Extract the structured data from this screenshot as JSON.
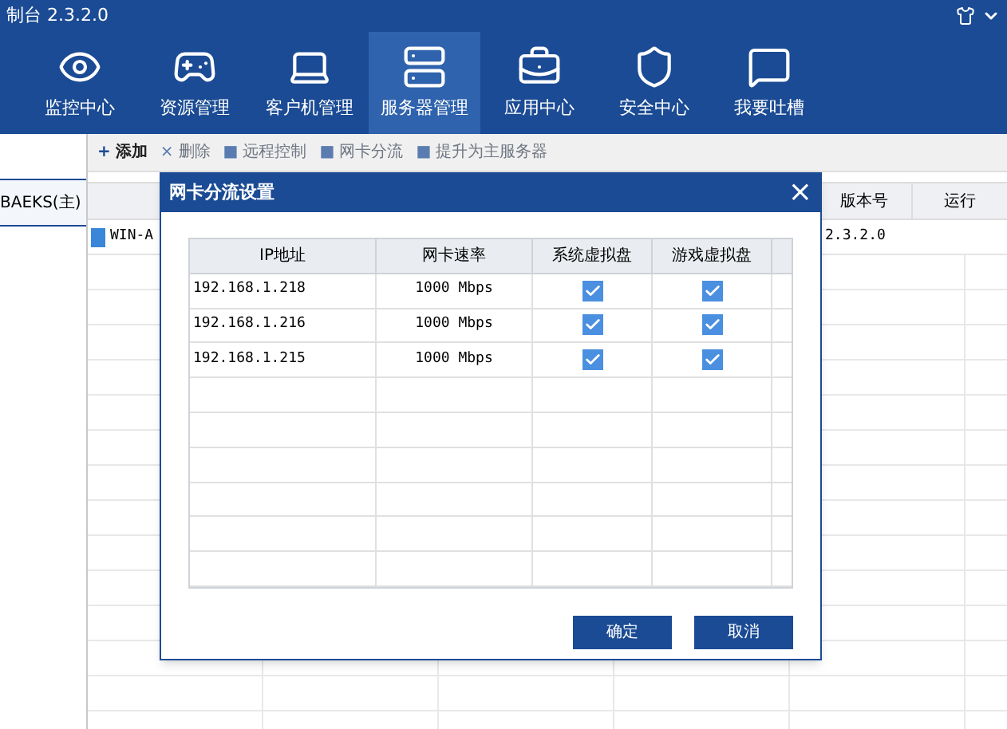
{
  "window": {
    "title": "制台 2.3.2.0"
  },
  "nav": [
    {
      "label": "监控中心",
      "kind": "eye",
      "selected": false
    },
    {
      "label": "资源管理",
      "kind": "gamepad",
      "selected": false
    },
    {
      "label": "客户机管理",
      "kind": "laptop",
      "selected": false
    },
    {
      "label": "服务器管理",
      "kind": "server",
      "selected": true
    },
    {
      "label": "应用中心",
      "kind": "toolbox",
      "selected": false
    },
    {
      "label": "安全中心",
      "kind": "shield",
      "selected": false
    },
    {
      "label": "我要吐槽",
      "kind": "message",
      "selected": false
    }
  ],
  "sidebar": {
    "items": [
      {
        "label": "BAEKS(主)",
        "selected": true
      }
    ]
  },
  "toolbar": [
    {
      "label": "添加",
      "icon": "+",
      "disabled": false
    },
    {
      "label": "删除",
      "icon": "×",
      "disabled": true
    },
    {
      "label": "远程控制",
      "icon": "■",
      "disabled": true
    },
    {
      "label": "网卡分流",
      "icon": "■",
      "disabled": true
    },
    {
      "label": "提升为主服务器",
      "icon": "■",
      "disabled": true
    }
  ],
  "table": {
    "columns": [
      "版本号",
      "运行"
    ],
    "rows": [
      {
        "name": "WIN-A",
        "version": "2.3.2.0"
      }
    ]
  },
  "dialog": {
    "title": "网卡分流设置",
    "close": "×",
    "columns": [
      "IP地址",
      "网卡速率",
      "系统虚拟盘",
      "游戏虚拟盘"
    ],
    "rows": [
      {
        "ip": "192.168.1.218",
        "speed": "1000 Mbps",
        "system_disk": true,
        "game_disk": true
      },
      {
        "ip": "192.168.1.216",
        "speed": "1000 Mbps",
        "system_disk": true,
        "game_disk": true
      },
      {
        "ip": "192.168.1.215",
        "speed": "1000 Mbps",
        "system_disk": true,
        "game_disk": true
      }
    ],
    "buttons": [
      "确定",
      "取消"
    ]
  }
}
